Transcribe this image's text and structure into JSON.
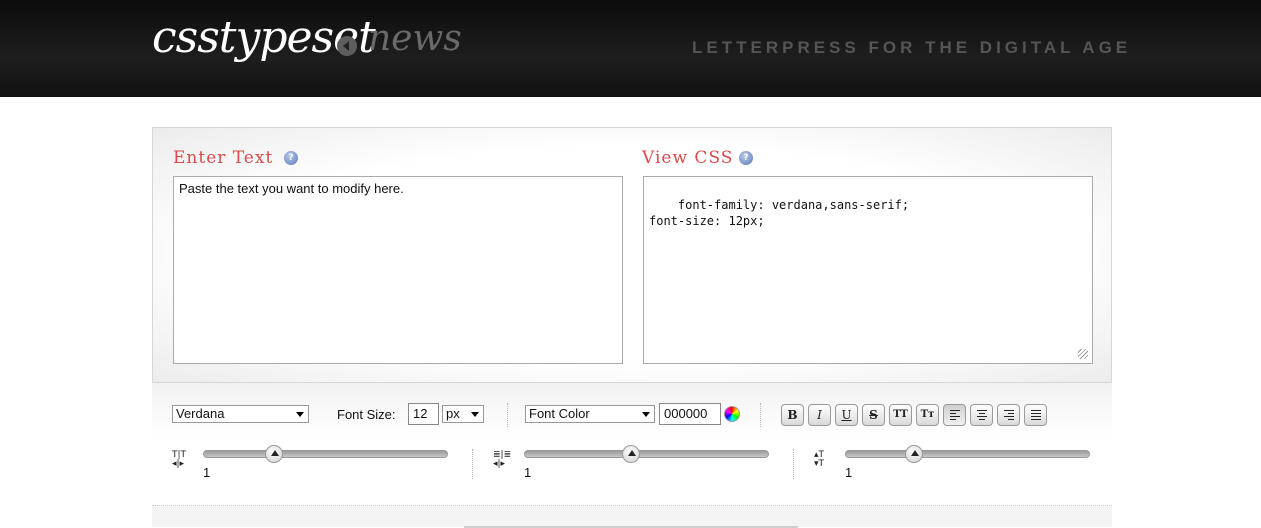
{
  "header": {
    "logo": "csstypeset",
    "logo_suffix": "news",
    "tagline": "LETTERPRESS FOR THE DIGITAL AGE"
  },
  "enter_text": {
    "title": "Enter Text",
    "help": "?",
    "value": "Paste the text you want to modify here."
  },
  "view_css": {
    "title": "View CSS",
    "help": "?",
    "value": "font-family: verdana,sans-serif;\nfont-size: 12px;"
  },
  "controls": {
    "font_family": "Verdana",
    "font_size_label": "Font Size:",
    "font_size": "12",
    "font_unit": "px",
    "font_color_label": "Font Color",
    "font_color_value": "000000",
    "buttons": {
      "bold": "B",
      "italic": "I",
      "underline": "U",
      "strike": "S",
      "uppercase": "TT",
      "capitalize": "Tт"
    }
  },
  "sliders": [
    {
      "icon": "letter-spacing-icon",
      "value": "1",
      "level": 0.27
    },
    {
      "icon": "word-spacing-icon",
      "value": "1",
      "level": 0.43
    },
    {
      "icon": "line-height-icon",
      "value": "1",
      "level": 0.26
    }
  ]
}
